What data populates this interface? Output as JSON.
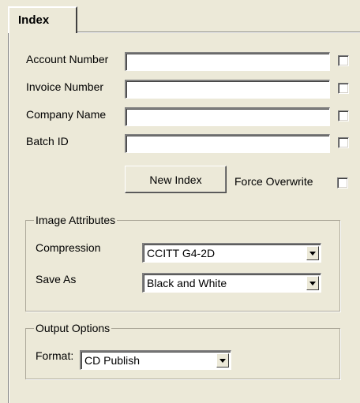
{
  "tab": {
    "label": "Index"
  },
  "fields": [
    {
      "label": "Account Number",
      "value": ""
    },
    {
      "label": "Invoice Number",
      "value": ""
    },
    {
      "label": "Company Name",
      "value": ""
    },
    {
      "label": "Batch ID",
      "value": ""
    }
  ],
  "actions": {
    "new_index_label": "New Index",
    "force_overwrite_label": "Force Overwrite"
  },
  "image_attributes": {
    "title": "Image Attributes",
    "compression_label": "Compression",
    "compression_value": "CCITT G4-2D",
    "save_as_label": "Save As",
    "save_as_value": "Black and White"
  },
  "output_options": {
    "title": "Output Options",
    "format_label": "Format:",
    "format_value": "CD Publish"
  },
  "icons": {
    "dropdown_arrow": "chevron-down-icon"
  }
}
